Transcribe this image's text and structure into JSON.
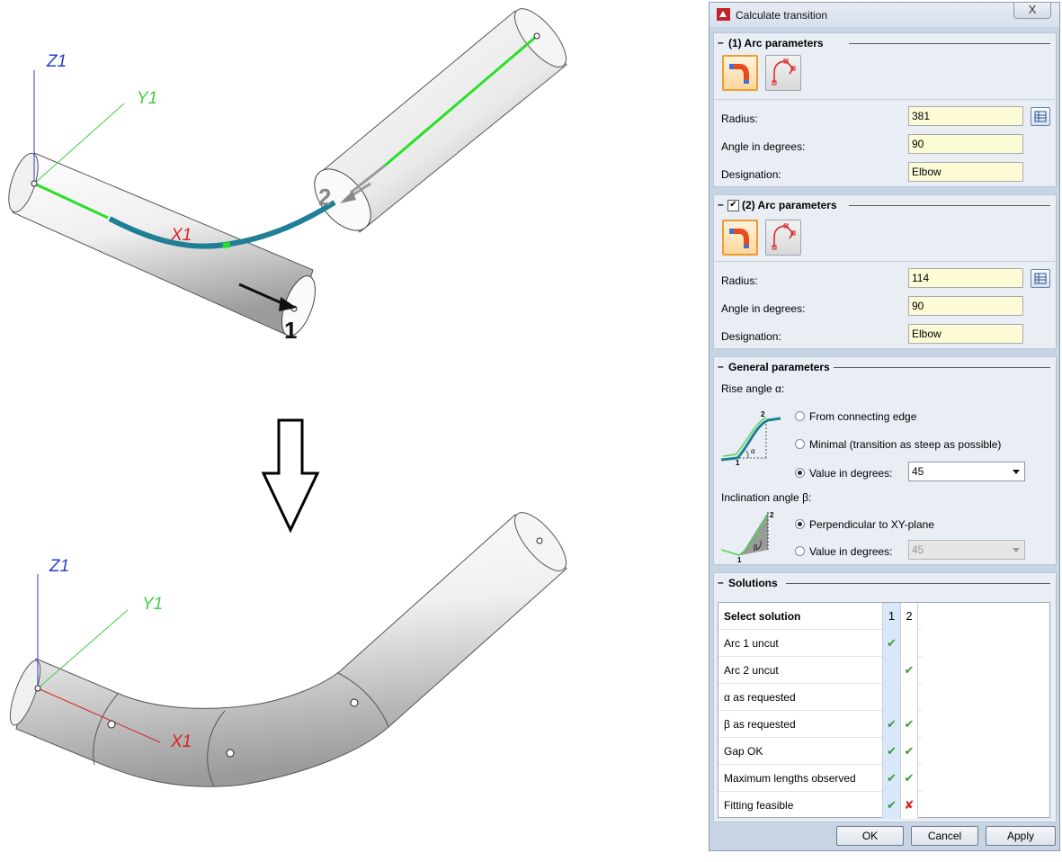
{
  "view_top": {
    "axis_z": "Z1",
    "axis_y": "Y1",
    "axis_x": "X1",
    "marker_1": "1",
    "marker_2": "2"
  },
  "view_bottom": {
    "axis_z": "Z1",
    "axis_y": "Y1",
    "axis_x": "X1"
  },
  "dialog": {
    "title": "Calculate transition",
    "close_label": "X",
    "arc1": {
      "header": "(1) Arc parameters",
      "radius_label": "Radius:",
      "radius_value": "381",
      "angle_label": "Angle in degrees:",
      "angle_value": "90",
      "designation_label": "Designation:",
      "designation_value": "Elbow"
    },
    "arc2": {
      "header": "(2) Arc parameters",
      "checked": true,
      "radius_label": "Radius:",
      "radius_value": "114",
      "angle_label": "Angle in degrees:",
      "angle_value": "90",
      "designation_label": "Designation:",
      "designation_value": "Elbow"
    },
    "general": {
      "header": "General parameters",
      "rise_label": "Rise angle α:",
      "rise_options": [
        "From connecting edge",
        "Minimal (transition as steep as possible)",
        "Value in degrees:"
      ],
      "rise_selected": 2,
      "rise_value": "45",
      "incl_label": "Inclination angle β:",
      "incl_options": [
        "Perpendicular to XY-plane",
        "Value in degrees:"
      ],
      "incl_selected": 0,
      "incl_value": "45",
      "diagram_labels": {
        "p1": "1",
        "p2": "2",
        "alpha": "α",
        "beta": "β"
      }
    },
    "solutions": {
      "header": "Solutions",
      "col_header": "Select solution",
      "columns": [
        "1",
        "2"
      ],
      "rows": [
        {
          "label": "Arc 1 uncut",
          "c1": "✔",
          "c2": ""
        },
        {
          "label": "Arc 2 uncut",
          "c1": "",
          "c2": "✔"
        },
        {
          "label": "α as requested",
          "c1": "",
          "c2": ""
        },
        {
          "label": "β as requested",
          "c1": "✔",
          "c2": "✔"
        },
        {
          "label": "Gap OK",
          "c1": "✔",
          "c2": "✔"
        },
        {
          "label": "Maximum lengths observed",
          "c1": "✔",
          "c2": "✔"
        },
        {
          "label": "Fitting feasible",
          "c1": "✔",
          "c2": "✘"
        }
      ]
    },
    "buttons": {
      "ok": "OK",
      "cancel": "Cancel",
      "apply": "Apply"
    }
  },
  "colors": {
    "accent_orange": "#f09a2e",
    "check_green": "#3d9a3d",
    "cross_red": "#d9201c",
    "pipe_teal": "#1f7f94"
  }
}
